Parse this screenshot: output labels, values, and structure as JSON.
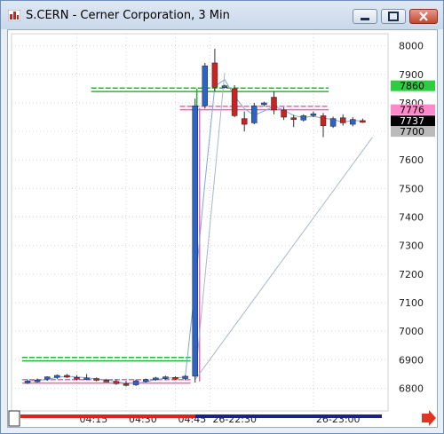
{
  "window": {
    "title": "S.CERN - Cerner Corporation, 3 Min",
    "icons": [
      "chart-icon",
      "minimize-icon",
      "maximize-icon",
      "close-icon",
      "scroll-right-arrow-icon"
    ]
  },
  "chart_data": {
    "type": "candlestick",
    "ylim": [
      6760,
      8030
    ],
    "y_ticks": [
      "8000",
      "7900",
      "7800",
      "7700",
      "7600",
      "7500",
      "7400",
      "7300",
      "7200",
      "7100",
      "7000",
      "6900",
      "6800"
    ],
    "x_ticks": [
      "04:15",
      "04:30",
      "04:45",
      "26-22:30",
      "26-23:00"
    ],
    "price_tags": [
      {
        "label": "7860",
        "value": 7860,
        "color": "#2ecc40"
      },
      {
        "label": "7776",
        "value": 7776,
        "color": "#ff88cc"
      },
      {
        "label": "7737",
        "value": 7737,
        "color": "#000000"
      },
      {
        "label": "7700",
        "value": 7700,
        "color": "#bbbbbb"
      }
    ],
    "green_bands": [
      {
        "from": 7840,
        "to": 7852,
        "x_range": [
          7,
          30
        ]
      },
      {
        "from": 6896,
        "to": 6908,
        "x_range": [
          0,
          16
        ]
      }
    ],
    "pink_bands": [
      {
        "from": 7776,
        "to": 7788,
        "x_range": [
          16,
          30
        ]
      },
      {
        "from": 6818,
        "to": 6830,
        "x_range": [
          0,
          16
        ]
      }
    ],
    "candles": [
      {
        "o": 6822,
        "h": 6830,
        "l": 6815,
        "c": 6825
      },
      {
        "o": 6826,
        "h": 6834,
        "l": 6820,
        "c": 6829
      },
      {
        "o": 6832,
        "h": 6842,
        "l": 6826,
        "c": 6840
      },
      {
        "o": 6838,
        "h": 6848,
        "l": 6832,
        "c": 6845
      },
      {
        "o": 6845,
        "h": 6850,
        "l": 6836,
        "c": 6840
      },
      {
        "o": 6838,
        "h": 6845,
        "l": 6828,
        "c": 6834
      },
      {
        "o": 6835,
        "h": 6850,
        "l": 6830,
        "c": 6836
      },
      {
        "o": 6834,
        "h": 6838,
        "l": 6824,
        "c": 6828
      },
      {
        "o": 6828,
        "h": 6833,
        "l": 6822,
        "c": 6826
      },
      {
        "o": 6824,
        "h": 6831,
        "l": 6812,
        "c": 6816
      },
      {
        "o": 6816,
        "h": 6826,
        "l": 6806,
        "c": 6810
      },
      {
        "o": 6812,
        "h": 6830,
        "l": 6808,
        "c": 6826
      },
      {
        "o": 6828,
        "h": 6834,
        "l": 6820,
        "c": 6830
      },
      {
        "o": 6832,
        "h": 6840,
        "l": 6826,
        "c": 6836
      },
      {
        "o": 6836,
        "h": 6844,
        "l": 6830,
        "c": 6840
      },
      {
        "o": 6838,
        "h": 6842,
        "l": 6830,
        "c": 6834
      },
      {
        "o": 6834,
        "h": 6846,
        "l": 6828,
        "c": 6842
      },
      {
        "o": 6842,
        "h": 7815,
        "l": 6820,
        "c": 7790
      },
      {
        "o": 7790,
        "h": 7940,
        "l": 7780,
        "c": 7930
      },
      {
        "o": 7940,
        "h": 7990,
        "l": 7840,
        "c": 7855
      },
      {
        "o": 7858,
        "h": 7864,
        "l": 7852,
        "c": 7860
      },
      {
        "o": 7850,
        "h": 7862,
        "l": 7750,
        "c": 7755
      },
      {
        "o": 7745,
        "h": 7770,
        "l": 7700,
        "c": 7725
      },
      {
        "o": 7730,
        "h": 7800,
        "l": 7725,
        "c": 7790
      },
      {
        "o": 7795,
        "h": 7804,
        "l": 7788,
        "c": 7800
      },
      {
        "o": 7820,
        "h": 7840,
        "l": 7760,
        "c": 7775
      },
      {
        "o": 7775,
        "h": 7785,
        "l": 7740,
        "c": 7750
      },
      {
        "o": 7748,
        "h": 7758,
        "l": 7715,
        "c": 7742
      },
      {
        "o": 7740,
        "h": 7760,
        "l": 7735,
        "c": 7755
      },
      {
        "o": 7760,
        "h": 7770,
        "l": 7750,
        "c": 7762
      },
      {
        "o": 7755,
        "h": 7765,
        "l": 7680,
        "c": 7720
      },
      {
        "o": 7718,
        "h": 7752,
        "l": 7712,
        "c": 7745
      },
      {
        "o": 7748,
        "h": 7760,
        "l": 7720,
        "c": 7730
      },
      {
        "o": 7725,
        "h": 7750,
        "l": 7718,
        "c": 7742
      },
      {
        "o": 7738,
        "h": 7745,
        "l": 7730,
        "c": 7735
      }
    ],
    "colors": {
      "up": "#2c63c7",
      "down": "#cc2222",
      "wick": "#333333",
      "ma": "#7fa8d9",
      "trend": "#a9b8c8",
      "grid": "#d6d6d6"
    }
  }
}
